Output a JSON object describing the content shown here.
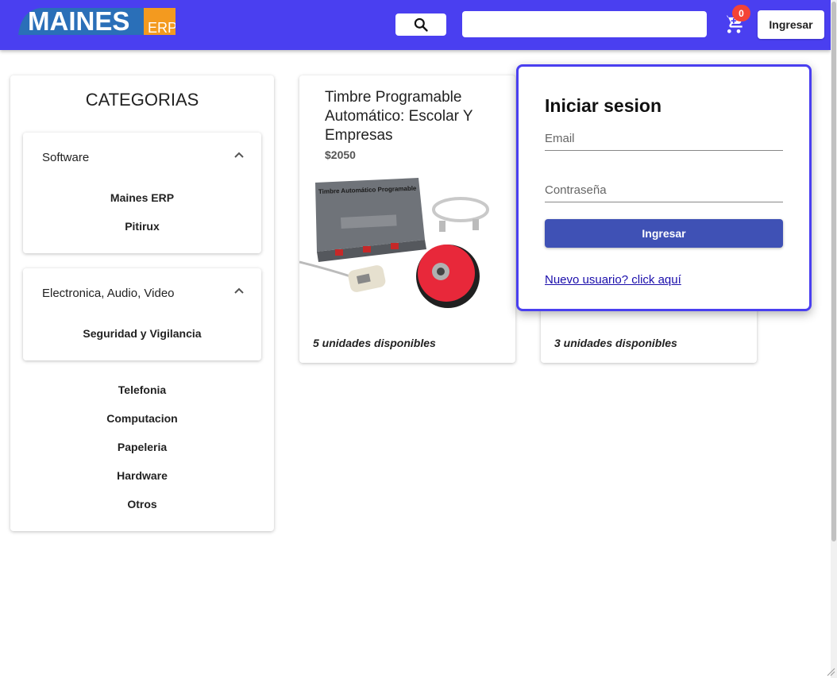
{
  "header": {
    "logo_main": "MAINES",
    "logo_sub": "ERP",
    "search_placeholder": "",
    "cart_count": "0",
    "login_button": "Ingresar"
  },
  "sidebar": {
    "title": "CATEGORIAS",
    "groups": [
      {
        "label": "Software",
        "items": [
          "Maines ERP",
          "Pitirux"
        ]
      },
      {
        "label": "Electronica, Audio, Video",
        "items": [
          "Seguridad y Vigilancia"
        ]
      }
    ],
    "plain_items": [
      "Telefonia",
      "Computacion",
      "Papeleria",
      "Hardware",
      "Otros"
    ]
  },
  "products": [
    {
      "title": "Timbre Programable Automático: Escolar Y Empresas",
      "price": "$2050",
      "stock": "5 unidades disponibles",
      "image_label": "Timbre Automático Programable"
    },
    {
      "title": "",
      "price": "",
      "stock": "3 unidades disponibles"
    }
  ],
  "login": {
    "title": "Iniciar sesion",
    "email_placeholder": "Email",
    "password_placeholder": "Contraseña",
    "submit": "Ingresar",
    "register_link": "Nuevo usuario? click aquí"
  },
  "colors": {
    "brand": "#4a3ff0",
    "button_primary": "#3f51b5",
    "badge": "#f44336"
  }
}
